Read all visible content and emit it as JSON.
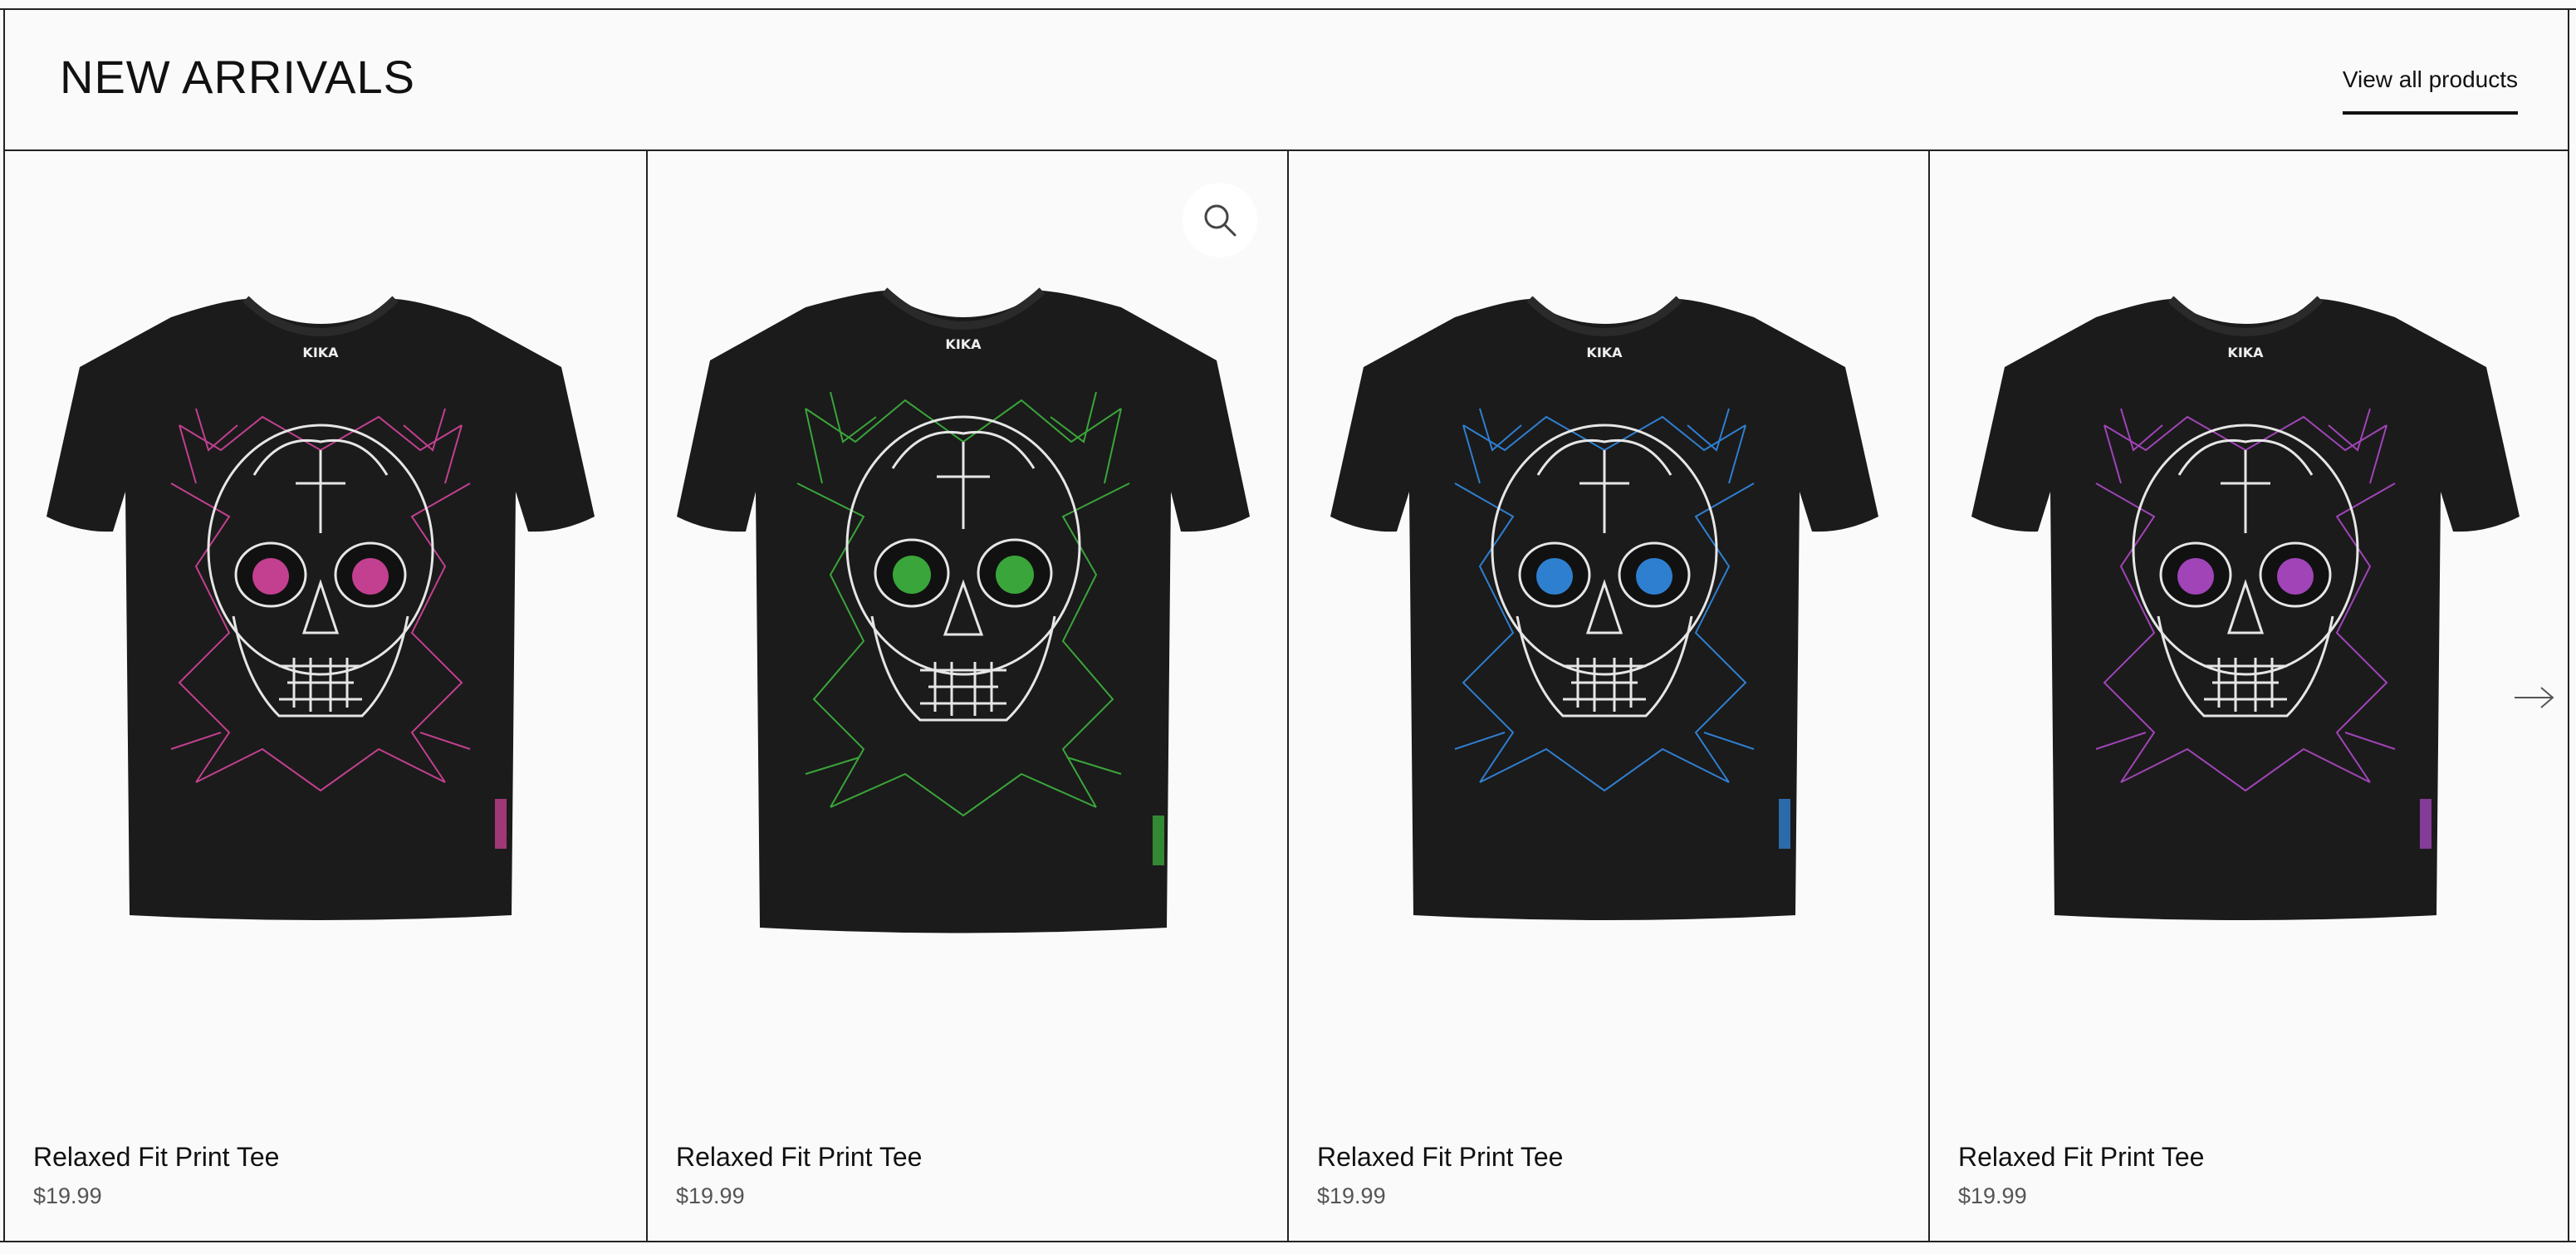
{
  "section": {
    "title": "NEW ARRIVALS",
    "view_all_label": "View all products"
  },
  "products": [
    {
      "name": "Relaxed Fit Print Tee",
      "price": "$19.99",
      "accent_color": "#c2408f",
      "brand": "KIKA"
    },
    {
      "name": "Relaxed Fit Print Tee",
      "price": "$19.99",
      "accent_color": "#3aa53a",
      "brand": "KIKA"
    },
    {
      "name": "Relaxed Fit Print Tee",
      "price": "$19.99",
      "accent_color": "#2f7fd0",
      "brand": "KIKA"
    },
    {
      "name": "Relaxed Fit Print Tee",
      "price": "$19.99",
      "accent_color": "#a044b8",
      "brand": "KIKA"
    }
  ],
  "icons": {
    "zoom": "search-icon",
    "next": "arrow-right-icon"
  }
}
